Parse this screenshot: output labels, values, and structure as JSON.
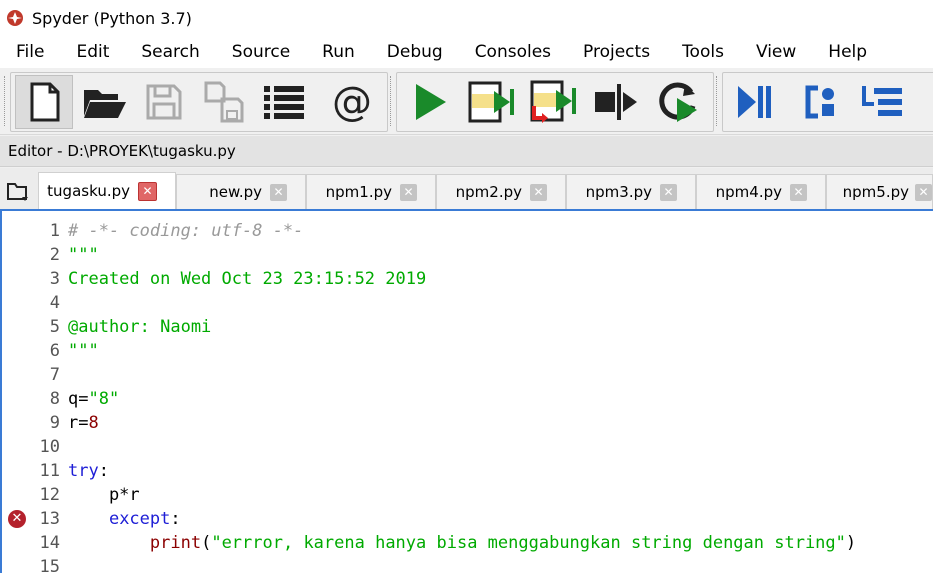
{
  "window": {
    "title": "Spyder (Python 3.7)"
  },
  "menu": [
    "File",
    "Edit",
    "Search",
    "Source",
    "Run",
    "Debug",
    "Consoles",
    "Projects",
    "Tools",
    "View",
    "Help"
  ],
  "toolbar": {
    "icons": [
      "new-file-icon",
      "open-file-icon",
      "save-file-icon",
      "save-all-icon",
      "outline-icon",
      "at-icon",
      "run-icon",
      "run-cell-icon",
      "run-cell-advance-icon",
      "run-selection-icon",
      "rerun-icon",
      "debug-continue-icon",
      "step-icon",
      "step-into-icon",
      "step-return-icon"
    ]
  },
  "editor": {
    "label": "Editor - D:\\PROYEK\\tugasku.py",
    "tabs": [
      {
        "label": "tugasku.py",
        "active": true
      },
      {
        "label": "new.py",
        "active": false
      },
      {
        "label": "npm1.py",
        "active": false
      },
      {
        "label": "npm2.py",
        "active": false
      },
      {
        "label": "npm3.py",
        "active": false
      },
      {
        "label": "npm4.py",
        "active": false
      },
      {
        "label": "npm5.py",
        "active": false
      }
    ],
    "lines": [
      {
        "n": "1",
        "segments": [
          [
            "# -*- coding: utf-8 -*-",
            "c-comment"
          ]
        ]
      },
      {
        "n": "2",
        "segments": [
          [
            "\"\"\"",
            "c-string"
          ]
        ]
      },
      {
        "n": "3",
        "segments": [
          [
            "Created on Wed Oct 23 23:15:52 2019",
            "c-string"
          ]
        ]
      },
      {
        "n": "4",
        "segments": []
      },
      {
        "n": "5",
        "segments": [
          [
            "@author: Naomi",
            "c-string"
          ]
        ]
      },
      {
        "n": "6",
        "segments": [
          [
            "\"\"\"",
            "c-string"
          ]
        ]
      },
      {
        "n": "7",
        "segments": []
      },
      {
        "n": "8",
        "segments": [
          [
            "q=",
            "c-plain"
          ],
          [
            "\"8\"",
            "c-string"
          ]
        ]
      },
      {
        "n": "9",
        "segments": [
          [
            "r=",
            "c-plain"
          ],
          [
            "8",
            "c-num"
          ]
        ]
      },
      {
        "n": "10",
        "segments": []
      },
      {
        "n": "11",
        "segments": [
          [
            "try",
            "c-kw"
          ],
          [
            ":",
            "c-plain"
          ]
        ]
      },
      {
        "n": "12",
        "segments": [
          [
            "    p*r",
            "c-plain"
          ]
        ]
      },
      {
        "n": "13",
        "error": true,
        "segments": [
          [
            "    ",
            "c-plain"
          ],
          [
            "except",
            "c-kw"
          ],
          [
            ":",
            "c-plain"
          ]
        ]
      },
      {
        "n": "14",
        "segments": [
          [
            "        ",
            "c-plain"
          ],
          [
            "print",
            "c-builtin"
          ],
          [
            "(",
            "c-plain"
          ],
          [
            "\"errror, karena hanya bisa menggabungkan string dengan string\"",
            "c-string"
          ],
          [
            ")",
            "c-plain"
          ]
        ]
      },
      {
        "n": "15",
        "segments": []
      }
    ]
  },
  "colors": {
    "accent": "#3a7bd5",
    "string": "#00aa00",
    "keyword": "#1e1ed6",
    "error": "#b4212c"
  }
}
